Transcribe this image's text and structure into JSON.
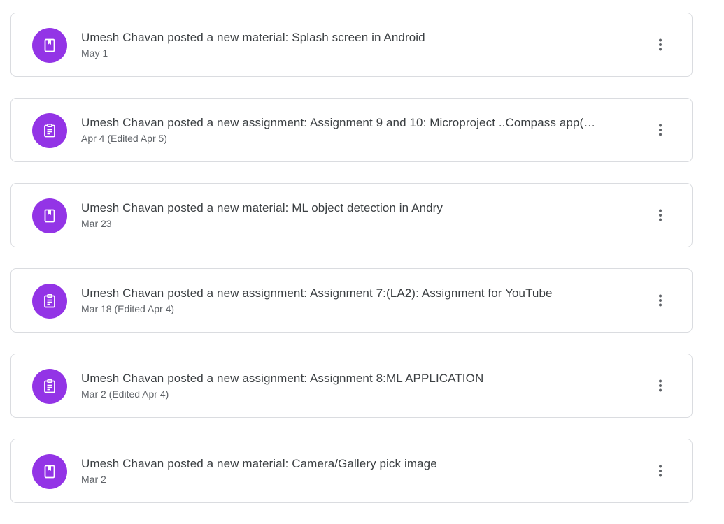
{
  "colors": {
    "accent": "#9334e6",
    "title_text": "#3c4043",
    "date_text": "#5f6368",
    "card_border": "#dadce0",
    "more_icon": "#5f6368"
  },
  "stream": {
    "posts": [
      {
        "type": "material",
        "icon": "material-icon",
        "title": "Umesh Chavan posted a new material: Splash screen in Android",
        "date": "May 1"
      },
      {
        "type": "assignment",
        "icon": "assignment-icon",
        "title": "Umesh Chavan posted a new assignment: Assignment 9 and 10: Microproject ..Compass app(…",
        "date": "Apr 4 (Edited Apr 5)"
      },
      {
        "type": "material",
        "icon": "material-icon",
        "title": "Umesh Chavan posted a new material: ML object detection in Andry",
        "date": "Mar 23"
      },
      {
        "type": "assignment",
        "icon": "assignment-icon",
        "title": "Umesh Chavan posted a new assignment: Assignment 7:(LA2): Assignment for YouTube",
        "date": "Mar 18 (Edited Apr 4)"
      },
      {
        "type": "assignment",
        "icon": "assignment-icon",
        "title": "Umesh Chavan posted a new assignment: Assignment 8:ML APPLICATION",
        "date": "Mar 2 (Edited Apr 4)"
      },
      {
        "type": "material",
        "icon": "material-icon",
        "title": "Umesh Chavan posted a new material: Camera/Gallery pick image",
        "date": "Mar 2"
      }
    ],
    "more_icon": "more-vert-icon"
  }
}
